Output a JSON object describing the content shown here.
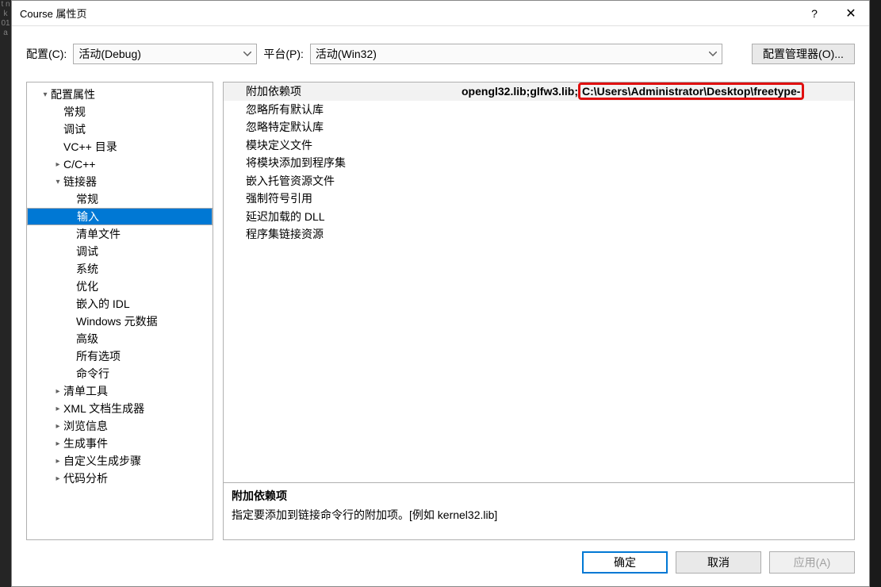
{
  "title": "Course 属性页",
  "help_icon": "?",
  "close_icon": "✕",
  "config_label": "配置(C):",
  "config_value": "活动(Debug)",
  "platform_label": "平台(P):",
  "platform_value": "活动(Win32)",
  "config_manager": "配置管理器(O)...",
  "tree": {
    "root": "配置属性",
    "general": "常规",
    "debug": "调试",
    "vcpp": "VC++ 目录",
    "ccpp": "C/C++",
    "linker": "链接器",
    "linker_children": {
      "general": "常规",
      "input": "输入",
      "manifest": "清单文件",
      "debug": "调试",
      "system": "系统",
      "optimize": "优化",
      "embedidl": "嵌入的 IDL",
      "winmd": "Windows 元数据",
      "advanced": "高级",
      "alloptions": "所有选项",
      "cmdline": "命令行"
    },
    "manifesttool": "清单工具",
    "xmldoc": "XML 文档生成器",
    "browse": "浏览信息",
    "buildevents": "生成事件",
    "custombuild": "自定义生成步骤",
    "codeanalysis": "代码分析"
  },
  "grid": {
    "r0k": "附加依赖项",
    "r0v_pre": "opengl32.lib;glfw3.lib;",
    "r0v_box": "C:\\Users\\Administrator\\Desktop\\freetype-",
    "r1": "忽略所有默认库",
    "r2": "忽略特定默认库",
    "r3": "模块定义文件",
    "r4": "将模块添加到程序集",
    "r5": "嵌入托管资源文件",
    "r6": "强制符号引用",
    "r7": "延迟加载的 DLL",
    "r8": "程序集链接资源"
  },
  "desc": {
    "title": "附加依赖项",
    "body": "指定要添加到链接命令行的附加项。[例如 kernel32.lib]"
  },
  "footer": {
    "ok": "确定",
    "cancel": "取消",
    "apply": "应用(A)"
  },
  "leftstrip": "t\n\n\n\n\n\n\n\n\n\nn\nk\n\n\n\n\n\n\n\n\n\n\n\n\n\n\n\n\n\n\n\n\n\n\n\n\n\n\n\n\n\n\n\n\n\n\n\n\n\n\n\n01\na"
}
